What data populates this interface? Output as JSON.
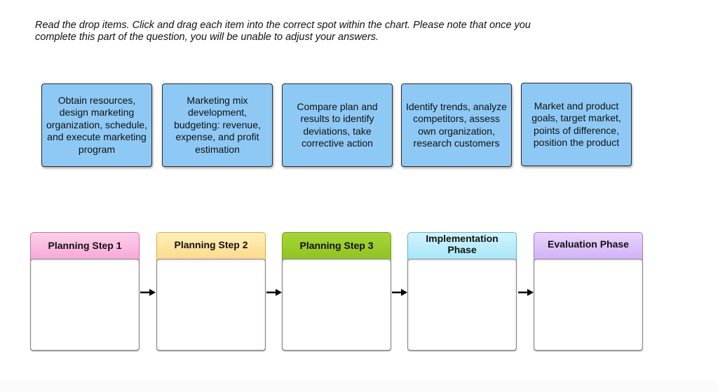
{
  "instructions": {
    "line1": "Read the drop items.  Click and drag each item into the correct spot within the chart. Please note that once you",
    "line2": "complete this part of the question, you will be unable to adjust your answers."
  },
  "drag_items": [
    {
      "text": "Obtain resources, design marketing organization, schedule, and execute marketing program"
    },
    {
      "text": "Marketing mix development, budgeting: revenue, expense, and profit estimation"
    },
    {
      "text": "Compare plan and results to identify deviations, take corrective action"
    },
    {
      "text": "Identify trends, analyze competitors, assess own organization, research customers"
    },
    {
      "text": "Market and product goals, target market, points of difference, position the product"
    }
  ],
  "drop_zones": [
    {
      "label": "Planning Step 1",
      "color": "#f7a6d6",
      "value": ""
    },
    {
      "label": "Planning Step 2",
      "color": "#fcd98a",
      "value": ""
    },
    {
      "label": "Planning Step 3",
      "color": "#8ec21e",
      "value": ""
    },
    {
      "label": "Implementation Phase",
      "color": "#a4e6f8",
      "value": ""
    },
    {
      "label": "Evaluation Phase",
      "color": "#d0b0f6",
      "value": ""
    }
  ],
  "arrows": [
    {
      "icon": "arrow-right-icon"
    },
    {
      "icon": "arrow-right-icon"
    },
    {
      "icon": "arrow-right-icon"
    },
    {
      "icon": "arrow-right-icon"
    }
  ],
  "colors": {
    "drag_item_bg": "#8ec9f5"
  }
}
